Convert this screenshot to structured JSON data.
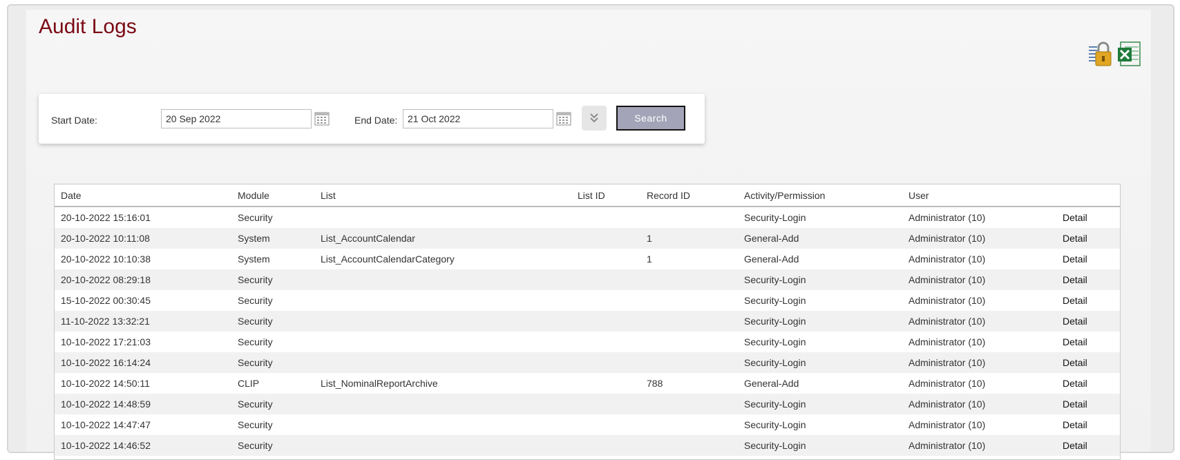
{
  "page": {
    "title": "Audit Logs"
  },
  "filters": {
    "start_label": "Start Date:",
    "start_value": "20 Sep 2022",
    "end_label": "End Date:",
    "end_value": "21 Oct 2022",
    "search_label": "Search"
  },
  "icons": {
    "export_permissions": "permissions-lock-icon",
    "export_excel": "excel-icon",
    "calendar": "calendar-icon",
    "expand": "chevron-double-down-icon"
  },
  "colors": {
    "title": "#7a0a14",
    "search_button": "#a4a4b8",
    "excel_green": "#1f7a3a"
  },
  "table": {
    "headers": {
      "date": "Date",
      "module": "Module",
      "list": "List",
      "list_id": "List ID",
      "record_id": "Record ID",
      "activity": "Activity/Permission",
      "user": "User"
    },
    "rows": [
      {
        "date": "20-10-2022 15:16:01",
        "module": "Security",
        "list": "",
        "list_id": "",
        "record_id": "",
        "activity": "Security-Login",
        "user": "Administrator (10)",
        "detail": "Detail"
      },
      {
        "date": "20-10-2022 10:11:08",
        "module": "System",
        "list": "List_AccountCalendar",
        "list_id": "",
        "record_id": "1",
        "activity": "General-Add",
        "user": "Administrator (10)",
        "detail": "Detail"
      },
      {
        "date": "20-10-2022 10:10:38",
        "module": "System",
        "list": "List_AccountCalendarCategory",
        "list_id": "",
        "record_id": "1",
        "activity": "General-Add",
        "user": "Administrator (10)",
        "detail": "Detail"
      },
      {
        "date": "20-10-2022 08:29:18",
        "module": "Security",
        "list": "",
        "list_id": "",
        "record_id": "",
        "activity": "Security-Login",
        "user": "Administrator (10)",
        "detail": "Detail"
      },
      {
        "date": "15-10-2022 00:30:45",
        "module": "Security",
        "list": "",
        "list_id": "",
        "record_id": "",
        "activity": "Security-Login",
        "user": "Administrator (10)",
        "detail": "Detail"
      },
      {
        "date": "11-10-2022 13:32:21",
        "module": "Security",
        "list": "",
        "list_id": "",
        "record_id": "",
        "activity": "Security-Login",
        "user": "Administrator (10)",
        "detail": "Detail"
      },
      {
        "date": "10-10-2022 17:21:03",
        "module": "Security",
        "list": "",
        "list_id": "",
        "record_id": "",
        "activity": "Security-Login",
        "user": "Administrator (10)",
        "detail": "Detail"
      },
      {
        "date": "10-10-2022 16:14:24",
        "module": "Security",
        "list": "",
        "list_id": "",
        "record_id": "",
        "activity": "Security-Login",
        "user": "Administrator (10)",
        "detail": "Detail"
      },
      {
        "date": "10-10-2022 14:50:11",
        "module": "CLIP",
        "list": "List_NominalReportArchive",
        "list_id": "",
        "record_id": "788",
        "activity": "General-Add",
        "user": "Administrator (10)",
        "detail": "Detail"
      },
      {
        "date": "10-10-2022 14:48:59",
        "module": "Security",
        "list": "",
        "list_id": "",
        "record_id": "",
        "activity": "Security-Login",
        "user": "Administrator (10)",
        "detail": "Detail"
      },
      {
        "date": "10-10-2022 14:47:47",
        "module": "Security",
        "list": "",
        "list_id": "",
        "record_id": "",
        "activity": "Security-Login",
        "user": "Administrator (10)",
        "detail": "Detail"
      },
      {
        "date": "10-10-2022 14:46:52",
        "module": "Security",
        "list": "",
        "list_id": "",
        "record_id": "",
        "activity": "Security-Login",
        "user": "Administrator (10)",
        "detail": "Detail"
      }
    ]
  }
}
